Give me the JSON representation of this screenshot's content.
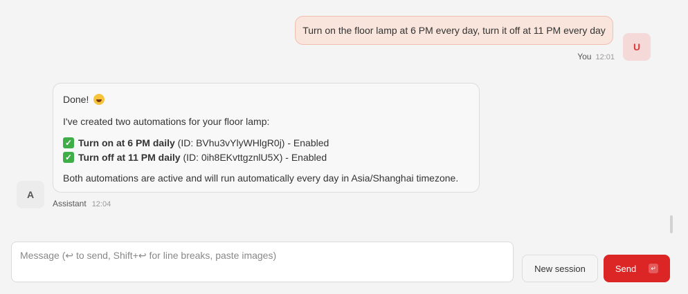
{
  "messages": {
    "user": {
      "text": "Turn on the floor lamp at 6 PM every day, turn it off at 11 PM every day",
      "sender": "You",
      "time": "12:01",
      "avatar": "U"
    },
    "assistant": {
      "greeting": "Done!",
      "greeting_emoji": "laughing-emoji",
      "intro": "I've created two automations for your floor lamp:",
      "automations": [
        {
          "name": "Turn on at 6 PM daily",
          "detail": "(ID: BVhu3vYlyWHlgR0j) - Enabled"
        },
        {
          "name": "Turn off at 11 PM daily",
          "detail": "(ID: 0ih8EKvttgznlU5X) - Enabled"
        }
      ],
      "summary": "Both automations are active and will run automatically every day in Asia/Shanghai timezone.",
      "sender": "Assistant",
      "time": "12:04",
      "avatar": "A"
    }
  },
  "composer": {
    "placeholder": "Message (↩ to send, Shift+↩ for line breaks, paste images)",
    "value": ""
  },
  "actions": {
    "new_session_label": "New session",
    "send_label": "Send",
    "send_shortcut_icon": "enter-key-icon"
  },
  "colors": {
    "accent": "#dc2626",
    "user_bubble_bg": "#f9e5dc",
    "user_bubble_border": "#efbfae",
    "check_green": "#3fae49"
  }
}
